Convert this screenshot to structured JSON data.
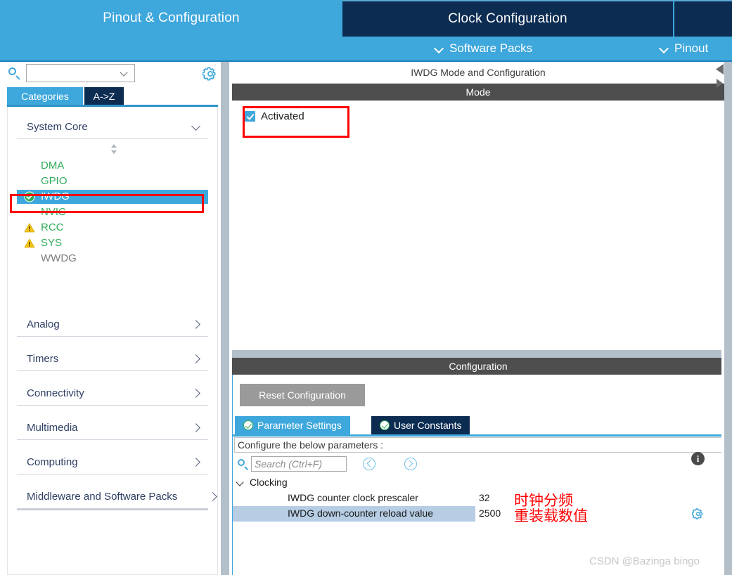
{
  "top_tabs": [
    {
      "label": "Pinout & Configuration",
      "active": true
    },
    {
      "label": "Clock Configuration",
      "active": false
    },
    {
      "label": "",
      "active": false
    }
  ],
  "sub_header": {
    "software_packs": "Software Packs",
    "pinout": "Pinout"
  },
  "left_panel": {
    "search": {
      "value": "",
      "placeholder": ""
    },
    "gear_icon": "gear-icon",
    "tabs": [
      {
        "label": "Categories",
        "active": true
      },
      {
        "label": "A->Z",
        "active": false
      }
    ],
    "sections": [
      {
        "label": "System Core",
        "expanded": true,
        "arrow": "chevron-down-icon"
      },
      {
        "label": "Analog",
        "expanded": false,
        "arrow": "chevron-right-icon"
      },
      {
        "label": "Timers",
        "expanded": false,
        "arrow": "chevron-right-icon"
      },
      {
        "label": "Connectivity",
        "expanded": false,
        "arrow": "chevron-right-icon"
      },
      {
        "label": "Multimedia",
        "expanded": false,
        "arrow": "chevron-right-icon"
      },
      {
        "label": "Computing",
        "expanded": false,
        "arrow": "chevron-right-icon"
      },
      {
        "label": "Middleware and Software Packs",
        "expanded": false,
        "arrow": "chevron-right-icon"
      }
    ],
    "tree_items": [
      {
        "label": "DMA",
        "icon": "none",
        "state": "configurable",
        "selected": false
      },
      {
        "label": "GPIO",
        "icon": "none",
        "state": "configurable",
        "selected": false
      },
      {
        "label": "IWDG",
        "icon": "green-check-icon",
        "state": "configured",
        "selected": true
      },
      {
        "label": "NVIC",
        "icon": "none",
        "state": "configurable",
        "selected": false
      },
      {
        "label": "RCC",
        "icon": "warning-icon",
        "state": "warning",
        "selected": false
      },
      {
        "label": "SYS",
        "icon": "warning-icon",
        "state": "warning",
        "selected": false
      },
      {
        "label": "WWDG",
        "icon": "none",
        "state": "disabled",
        "selected": false
      }
    ]
  },
  "right_panel": {
    "title": "IWDG Mode and Configuration",
    "mode": {
      "header": "Mode",
      "activated_label": "Activated",
      "activated_checked": true
    },
    "configuration": {
      "header": "Configuration",
      "reset_button": "Reset Configuration",
      "tabs": [
        {
          "label": "Parameter Settings",
          "active": true,
          "icon": "green-check-icon"
        },
        {
          "label": "User Constants",
          "active": false,
          "icon": "green-check-icon"
        }
      ],
      "hint": "Configure the below parameters :",
      "search": {
        "value": "",
        "placeholder": "Search (Ctrl+F)"
      },
      "nav_prev_icon": "chevron-left-circle-icon",
      "nav_next_icon": "chevron-right-circle-icon",
      "info_icon": "info-icon",
      "info_glyph": "i",
      "groups": [
        {
          "label": "Clocking",
          "expanded": true,
          "rows": [
            {
              "name": "IWDG counter clock prescaler",
              "value": "32",
              "annotation": "时钟分频",
              "selected": false,
              "gear": false
            },
            {
              "name": "IWDG down-counter reload value",
              "value": "2500",
              "annotation": "重装载数值",
              "selected": true,
              "gear": true
            }
          ]
        }
      ]
    }
  },
  "watermark": "CSDN @Bazinga bingo",
  "colors": {
    "accent_blue": "#3ea7dc",
    "dark_navy": "#0c2c52",
    "bar_gray": "#4e4e4e",
    "green": "#2fab5a",
    "warning_yellow": "#f5c518",
    "red_highlight": "#ff0000",
    "row_highlight": "#b6cde4"
  }
}
